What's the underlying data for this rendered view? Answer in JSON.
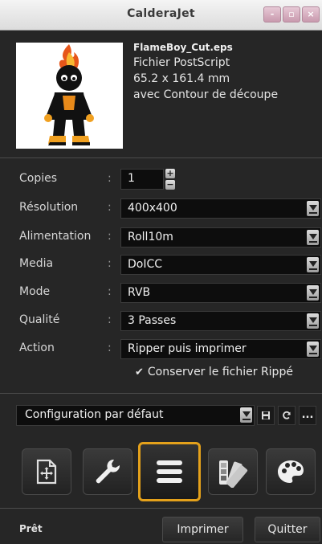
{
  "window": {
    "title": "CalderaJet",
    "controls": [
      "-",
      "▫",
      "×"
    ]
  },
  "file": {
    "name": "FlameBoy_Cut.eps",
    "type": "Fichier PostScript",
    "size": "65.2 x 161.4 mm",
    "note": "avec Contour de découpe"
  },
  "settings": {
    "copies": {
      "label": "Copies",
      "value": "1"
    },
    "resolution": {
      "label": "Résolution",
      "value": "400x400"
    },
    "feed": {
      "label": "Alimentation",
      "value": "Roll10m"
    },
    "media": {
      "label": "Media",
      "value": "DoICC"
    },
    "mode": {
      "label": "Mode",
      "value": "RVB"
    },
    "quality": {
      "label": "Qualité",
      "value": "3 Passes"
    },
    "action": {
      "label": "Action",
      "value": "Ripper puis imprimer"
    },
    "separator": ":",
    "keep_ripped": {
      "label": "Conserver le fichier Rippé",
      "checked": true,
      "mark": "✔"
    }
  },
  "config": {
    "value": "Configuration par défaut",
    "save_icon": "save-icon",
    "reload_icon": "refresh-icon",
    "more_label": "..."
  },
  "toolbar": {
    "active": "queue-list",
    "items": [
      "add-file",
      "settings-wrench",
      "queue-list",
      "color-swatches",
      "palette"
    ],
    "accent": "#e4a11b"
  },
  "footer": {
    "status": "Prêt",
    "print_label": "Imprimer",
    "quit_label": "Quitter"
  }
}
